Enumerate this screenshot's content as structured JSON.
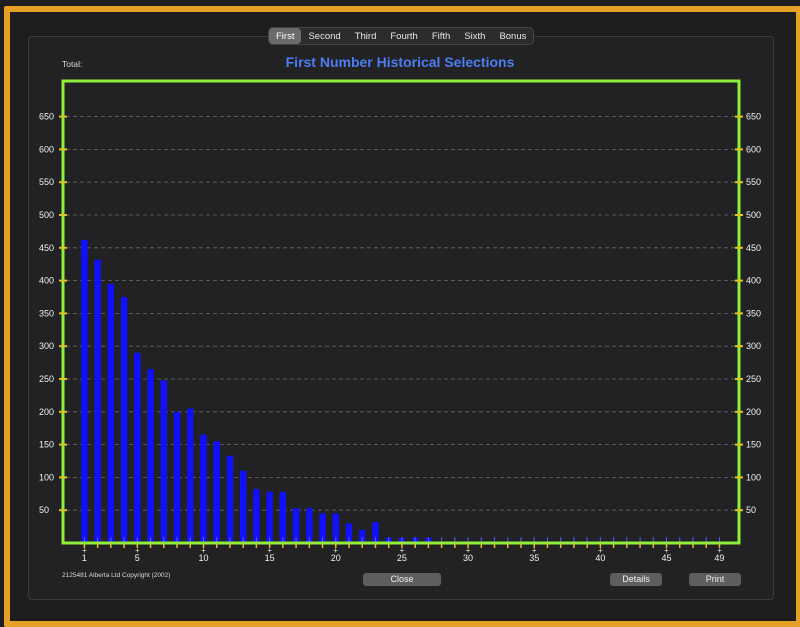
{
  "tabs": [
    "First",
    "Second",
    "Third",
    "Fourth",
    "Fifth",
    "Sixth",
    "Bonus"
  ],
  "selected_tab": 0,
  "total_label": "Total:",
  "footer": {
    "copyright": "2125481 Alberta Ltd Copyright (2002)",
    "close_label": "Close",
    "details_label": "Details",
    "print_label": "Print"
  },
  "colors": {
    "bar": "#1010ff",
    "frame": "#e6a025",
    "plot_border": "#8ef03a",
    "tick": "#e6c020",
    "title": "#4d7df2"
  },
  "chart_data": {
    "type": "bar",
    "title": "First Number Historical Selections",
    "xlabel": "",
    "ylabel": "",
    "xlim": [
      1,
      49
    ],
    "ylim": [
      0,
      650
    ],
    "x_ticks": [
      1,
      5,
      10,
      15,
      20,
      25,
      30,
      35,
      40,
      45,
      49
    ],
    "y_ticks": [
      50,
      100,
      150,
      200,
      250,
      300,
      350,
      400,
      450,
      500,
      550,
      600,
      650
    ],
    "grid": true,
    "categories": [
      1,
      2,
      3,
      4,
      5,
      6,
      7,
      8,
      9,
      10,
      11,
      12,
      13,
      14,
      15,
      16,
      17,
      18,
      19,
      20,
      21,
      22,
      23,
      24,
      25,
      26,
      27,
      28,
      29,
      30,
      31,
      32,
      33,
      34,
      35,
      36,
      37,
      38,
      39,
      40,
      41,
      42,
      43,
      44,
      45,
      46,
      47,
      48,
      49
    ],
    "values": [
      462,
      432,
      395,
      375,
      290,
      265,
      248,
      200,
      205,
      165,
      155,
      133,
      110,
      82,
      78,
      78,
      53,
      53,
      45,
      45,
      30,
      20,
      32,
      8,
      8,
      8,
      8,
      0,
      0,
      0,
      0,
      0,
      0,
      0,
      0,
      0,
      0,
      0,
      0,
      0,
      0,
      0,
      0,
      0,
      0,
      0,
      0,
      0,
      0
    ]
  }
}
